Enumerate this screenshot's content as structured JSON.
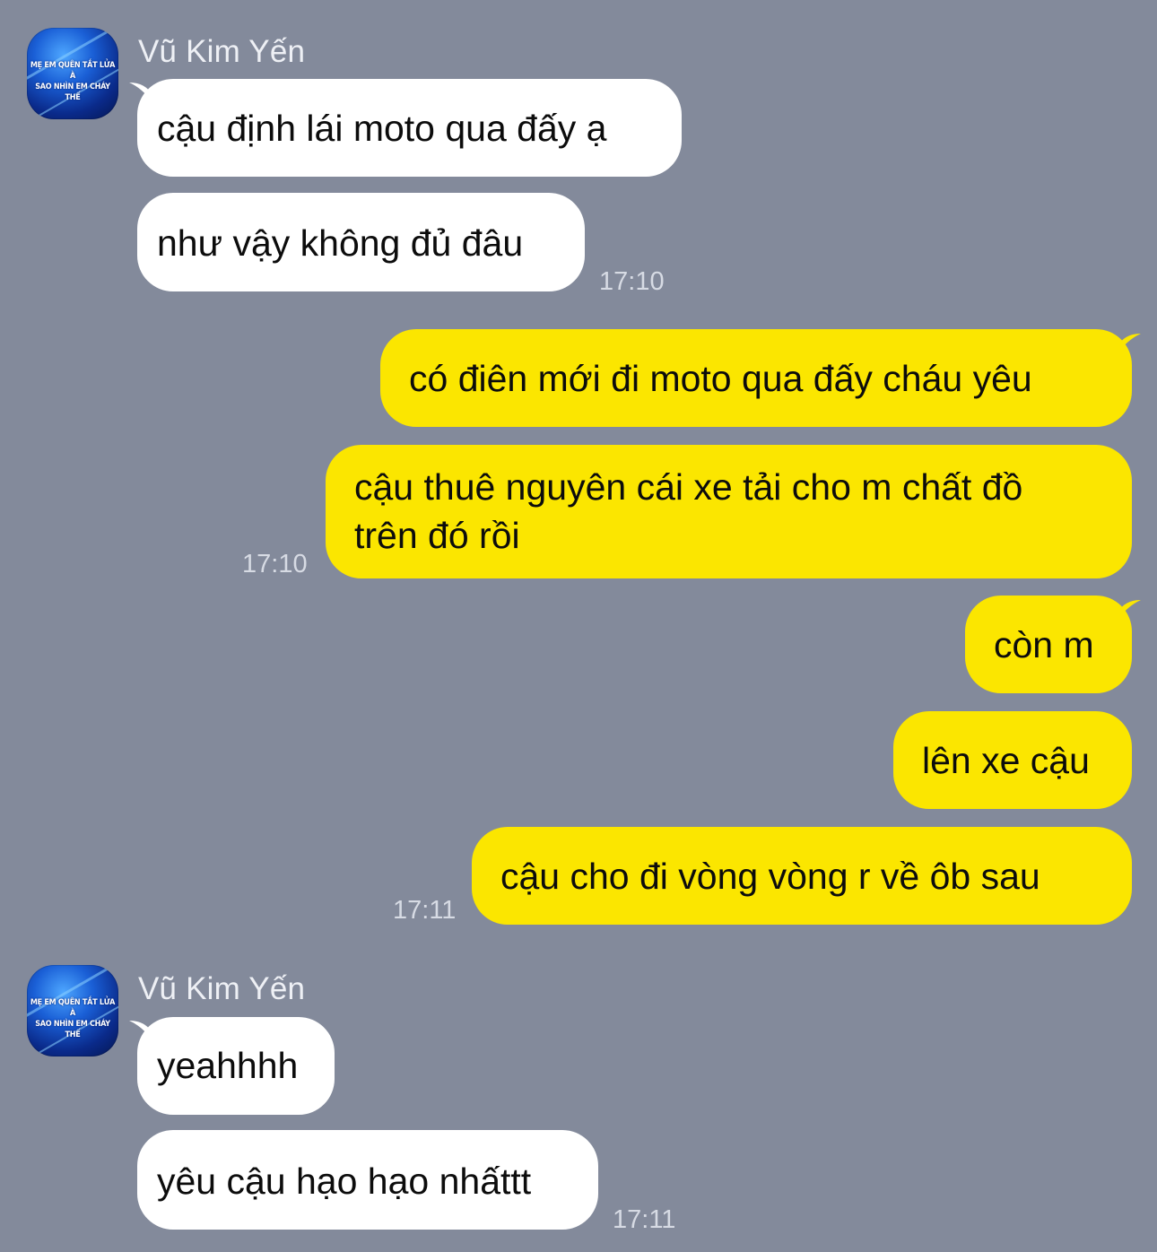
{
  "colors": {
    "background": "#838a9b",
    "incoming_bubble": "#ffffff",
    "outgoing_bubble": "#fbe600"
  },
  "avatar": {
    "caption_line1": "MẸ EM QUÊN TẮT LỬA À",
    "caption_line2": "SAO NHÌN EM CHÁY THẾ"
  },
  "messages": [
    {
      "sender": "Vũ Kim Yến",
      "direction": "in",
      "text": "cậu định lái moto qua đấy ạ"
    },
    {
      "direction": "in",
      "text": "như vậy không đủ đâu",
      "time": "17:10"
    },
    {
      "direction": "out",
      "text": "có điên mới đi moto qua đấy cháu yêu"
    },
    {
      "direction": "out",
      "text_line1": "cậu thuê nguyên cái xe tải cho m chất đồ",
      "text_line2": "trên đó rồi",
      "time": "17:10"
    },
    {
      "direction": "out",
      "text": "còn m"
    },
    {
      "direction": "out",
      "text": "lên xe cậu"
    },
    {
      "direction": "out",
      "text": "cậu cho đi vòng vòng r về ôb sau",
      "time": "17:11"
    },
    {
      "sender": "Vũ Kim Yến",
      "direction": "in",
      "text": "yeahhhh"
    },
    {
      "direction": "in",
      "text": "yêu cậu hạo hạo nhấttt",
      "time": "17:11"
    }
  ]
}
